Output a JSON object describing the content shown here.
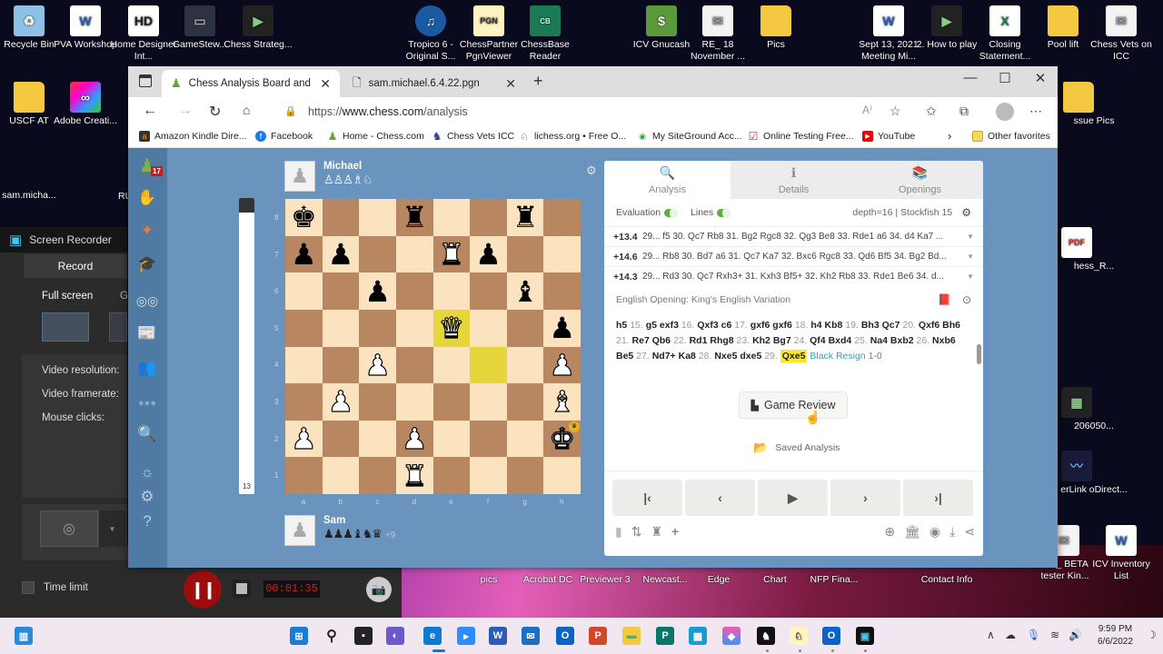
{
  "desktop": {
    "icons": [
      {
        "label": "Recycle Bin",
        "icon": "recycle-bin-icon"
      },
      {
        "label": "PVA Workshop",
        "icon": "word-doc-icon"
      },
      {
        "label": "Home Designer Int...",
        "icon": "home-designer-icon"
      },
      {
        "label": "GameStew...",
        "icon": "gamestew-icon"
      },
      {
        "label": "Chess Strateg...",
        "icon": "video-icon"
      },
      {
        "label": "Tropico 6 - Original S...",
        "icon": "music-icon"
      },
      {
        "label": "ChessPartner PgnViewer",
        "icon": "pgn-icon"
      },
      {
        "label": "ChessBase Reader",
        "icon": "chessbase-icon"
      },
      {
        "label": "ICV Gnucash",
        "icon": "gnucash-icon"
      },
      {
        "label": "RE_ 18 November ...",
        "icon": "mail-icon"
      },
      {
        "label": "Pics",
        "icon": "folder-icon"
      },
      {
        "label": "Sept 13, 2021 Meeting Mi...",
        "icon": "word-doc-icon"
      },
      {
        "label": "2. How to play",
        "icon": "video-icon"
      },
      {
        "label": "Closing Statement...",
        "icon": "excel-icon"
      },
      {
        "label": "Pool lift",
        "icon": "folder-icon"
      },
      {
        "label": "Chess Vets on ICC",
        "icon": "mail-icon"
      },
      {
        "label": "USCF AT",
        "icon": "folder-icon"
      },
      {
        "label": "Adobe Creati...",
        "icon": "creative-cloud-icon"
      },
      {
        "label": "sam.micha...",
        "icon": "file-icon"
      },
      {
        "label": "RU",
        "icon": "file-icon"
      },
      {
        "label": "ssue Pics",
        "icon": "folder-icon"
      },
      {
        "label": "hess_R...",
        "icon": "pdf-icon"
      },
      {
        "label": "206050...",
        "icon": "video-icon"
      },
      {
        "label": "erLink oDirect...",
        "icon": "powerdirector-icon"
      },
      {
        "label": "FW_ BETA tester Kin...",
        "icon": "mail-icon"
      },
      {
        "label": "ICV Inventory List",
        "icon": "word-doc-icon"
      },
      {
        "label": "pics",
        "icon": "folder-icon"
      },
      {
        "label": "Acrobat DC",
        "icon": "acrobat-icon"
      },
      {
        "label": "Previewer 3",
        "icon": "app-icon"
      },
      {
        "label": "Newcast...",
        "icon": "app-icon"
      },
      {
        "label": "Edge",
        "icon": "edge-icon"
      },
      {
        "label": "Chart",
        "icon": "app-icon"
      },
      {
        "label": "NFP Fina...",
        "icon": "app-icon"
      },
      {
        "label": "Contact Info",
        "icon": "app-icon"
      }
    ]
  },
  "recorder": {
    "title": "Screen Recorder",
    "tab": "Record",
    "mode_full": "Full screen",
    "mode_other": "G",
    "video_resolution": "Video resolution:",
    "video_framerate": "Video framerate:",
    "mouse_clicks": "Mouse clicks:",
    "time_limit": "Time limit",
    "elapsed": "00:01:35"
  },
  "browser": {
    "tabs": [
      {
        "title": "Chess Analysis Board and PGN E",
        "active": true
      },
      {
        "title": "sam.michael.6.4.22.pgn",
        "active": false
      }
    ],
    "url_prefix": "https://",
    "url_host": "www.chess.com",
    "url_path": "/analysis",
    "favorites": [
      {
        "label": "Amazon Kindle Dire...",
        "icon": "amazon-icon"
      },
      {
        "label": "Facebook",
        "icon": "facebook-icon"
      },
      {
        "label": "Home - Chess.com",
        "icon": "chesscom-icon"
      },
      {
        "label": "Chess Vets ICC",
        "icon": "icc-icon"
      },
      {
        "label": "lichess.org • Free O...",
        "icon": "lichess-icon"
      },
      {
        "label": "My SiteGround Acc...",
        "icon": "siteground-icon"
      },
      {
        "label": "Online Testing Free...",
        "icon": "checkbox-icon"
      },
      {
        "label": "YouTube",
        "icon": "youtube-icon"
      }
    ],
    "other_favorites": "Other favorites"
  },
  "chess": {
    "notification_count": "17",
    "eval_bar_value": "13",
    "eval_bar_white_fraction": 0.95,
    "top_player": {
      "name": "Michael",
      "captured": "♙♙♙♗♘",
      "advantage": ""
    },
    "bottom_player": {
      "name": "Sam",
      "captured": "♟♟♟♝♞♛",
      "advantage": "+9"
    },
    "files": [
      "a",
      "b",
      "c",
      "d",
      "e",
      "f",
      "g",
      "h"
    ],
    "ranks": [
      "8",
      "7",
      "6",
      "5",
      "4",
      "3",
      "2",
      "1"
    ],
    "board": [
      [
        "bk",
        "",
        "",
        "br",
        "",
        "",
        "br",
        ""
      ],
      [
        "bp",
        "bp",
        "",
        "",
        "wr",
        "bp",
        "",
        ""
      ],
      [
        "",
        "",
        "bp",
        "",
        "",
        "",
        "bb",
        ""
      ],
      [
        "",
        "",
        "",
        "",
        "wq",
        "",
        "",
        "bp"
      ],
      [
        "",
        "",
        "wp",
        "",
        "",
        "",
        "",
        "wp"
      ],
      [
        "",
        "wp",
        "",
        "",
        "",
        "",
        "",
        "wb"
      ],
      [
        "wp",
        "",
        "",
        "wp",
        "",
        "",
        "",
        "wk"
      ],
      [
        "",
        "",
        "",
        "wr",
        "",
        "",
        "",
        ""
      ]
    ],
    "highlighted_squares": [
      "e5",
      "f4"
    ],
    "winner_square": "h2"
  },
  "panel": {
    "tabs": [
      {
        "label": "Analysis",
        "icon": "analysis-icon",
        "active": true
      },
      {
        "label": "Details",
        "icon": "info-icon",
        "active": false
      },
      {
        "label": "Openings",
        "icon": "book-icon",
        "active": false
      }
    ],
    "evaluation_label": "Evaluation",
    "lines_label": "Lines",
    "engine_info": "depth=16 | Stockfish 15",
    "lines": [
      {
        "score": "+13.4",
        "moves": "29... f5 30. Qc7 Rb8 31. Bg2 Rgc8 32. Qg3 Be8 33. Rde1 a6 34. d4 Ka7 ..."
      },
      {
        "score": "+14.6",
        "moves": "29... Rb8 30. Bd7 a6 31. Qc7 Ka7 32. Bxc6 Rgc8 33. Qd6 Bf5 34. Bg2 Bd..."
      },
      {
        "score": "+14.3",
        "moves": "29... Rd3 30. Qc7 Rxh3+ 31. Kxh3 Bf5+ 32. Kh2 Rb8 33. Rde1 Be6 34. d..."
      }
    ],
    "opening": "English Opening: King's English Variation",
    "movelist": [
      {
        "t": "m",
        "v": "h5"
      },
      {
        "t": "n",
        "v": "15."
      },
      {
        "t": "m",
        "v": "g5"
      },
      {
        "t": "m",
        "v": "exf3"
      },
      {
        "t": "n",
        "v": "16."
      },
      {
        "t": "m",
        "v": "Qxf3"
      },
      {
        "t": "m",
        "v": "c6"
      },
      {
        "t": "n",
        "v": "17."
      },
      {
        "t": "m",
        "v": "gxf6"
      },
      {
        "t": "m",
        "v": "gxf6"
      },
      {
        "t": "n",
        "v": "18."
      },
      {
        "t": "m",
        "v": "h4"
      },
      {
        "t": "m",
        "v": "Kb8"
      },
      {
        "t": "n",
        "v": "19."
      },
      {
        "t": "m",
        "v": "Bh3"
      },
      {
        "t": "m",
        "v": "Qc7"
      },
      {
        "t": "n",
        "v": "20."
      },
      {
        "t": "m",
        "v": "Qxf6"
      },
      {
        "t": "m",
        "v": "Bh6"
      },
      {
        "t": "n",
        "v": "21."
      },
      {
        "t": "m",
        "v": "Re7"
      },
      {
        "t": "m",
        "v": "Qb6"
      },
      {
        "t": "n",
        "v": "22."
      },
      {
        "t": "m",
        "v": "Rd1"
      },
      {
        "t": "m",
        "v": "Rhg8"
      },
      {
        "t": "n",
        "v": "23."
      },
      {
        "t": "m",
        "v": "Kh2"
      },
      {
        "t": "m",
        "v": "Bg7"
      },
      {
        "t": "n",
        "v": "24."
      },
      {
        "t": "m",
        "v": "Qf4"
      },
      {
        "t": "m",
        "v": "Bxd4"
      },
      {
        "t": "n",
        "v": "25."
      },
      {
        "t": "m",
        "v": "Na4"
      },
      {
        "t": "m",
        "v": "Bxb2"
      },
      {
        "t": "n",
        "v": "26."
      },
      {
        "t": "m",
        "v": "Nxb6"
      },
      {
        "t": "m",
        "v": "Be5"
      },
      {
        "t": "n",
        "v": "27."
      },
      {
        "t": "m",
        "v": "Nd7+"
      },
      {
        "t": "m",
        "v": "Ka8"
      },
      {
        "t": "n",
        "v": "28."
      },
      {
        "t": "m",
        "v": "Nxe5"
      },
      {
        "t": "m",
        "v": "dxe5"
      },
      {
        "t": "n",
        "v": "29."
      },
      {
        "t": "c",
        "v": "Qxe5"
      },
      {
        "t": "r",
        "v": "Black Resign"
      },
      {
        "t": "s",
        "v": "1-0"
      }
    ],
    "game_review_label": "Game Review",
    "saved_analysis_label": "Saved Analysis"
  },
  "taskbar": {
    "time": "9:59 PM",
    "date": "6/6/2022"
  }
}
